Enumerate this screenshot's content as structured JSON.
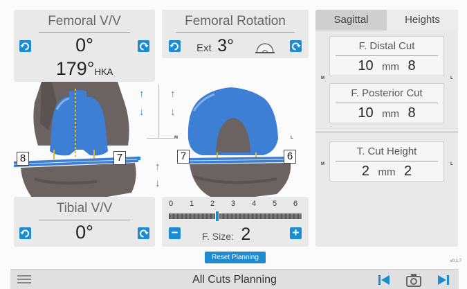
{
  "femoral_vv": {
    "title": "Femoral V/V",
    "value": "0°",
    "hka_value": "179°",
    "hka_unit": "HKA"
  },
  "femoral_rotation": {
    "title": "Femoral Rotation",
    "direction": "Ext",
    "value": "3°"
  },
  "tibial_vv": {
    "title": "Tibial V/V",
    "value": "0°"
  },
  "size": {
    "ticks": [
      "0",
      "1",
      "2",
      "3",
      "4",
      "5",
      "6"
    ],
    "label": "F. Size:",
    "value": "2",
    "current": 2.2,
    "minus": "−",
    "plus": "+"
  },
  "tabs": [
    {
      "label": "Sagittal"
    },
    {
      "label": "Heights"
    }
  ],
  "cuts": {
    "distal": {
      "title": "F. Distal Cut",
      "medial": "10",
      "unit": "mm",
      "lateral": "8"
    },
    "posterior": {
      "title": "F. Posterior Cut",
      "medial": "10",
      "unit": "mm",
      "lateral": "8"
    },
    "tibial": {
      "title": "T. Cut Height",
      "medial": "2",
      "unit": "mm",
      "lateral": "2"
    }
  },
  "side_marks": {
    "medial": "M",
    "lateral": "L"
  },
  "knee_labels": {
    "front_medial": "8",
    "front_lateral": "7",
    "side_left": "7",
    "side_right": "6"
  },
  "reset_button": "Reset Planning",
  "footer": {
    "title": "All Cuts Planning",
    "version": "v0.1.7"
  },
  "colors": {
    "accent": "#1d8bd0",
    "implant": "#3d7fd4",
    "bone": "#6b6361"
  },
  "icons": [
    "menu-icon",
    "skip-back-icon",
    "camera-icon",
    "skip-forward-icon",
    "rotate-left-icon",
    "rotate-right-icon",
    "arrow-up-icon",
    "arrow-down-icon"
  ]
}
